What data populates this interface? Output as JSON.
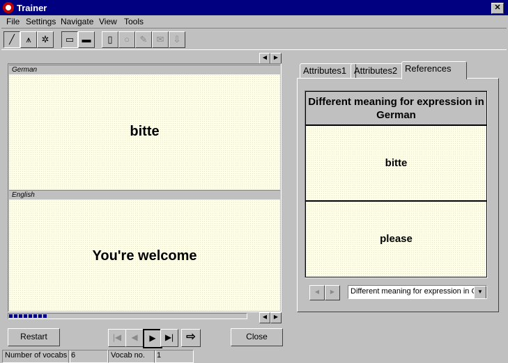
{
  "window": {
    "title": "Trainer",
    "close_glyph": "✕"
  },
  "menu": [
    "File",
    "Settings",
    "Navigate",
    "View",
    "Tools"
  ],
  "toolbar": [
    {
      "icon": "line-tool-icon",
      "glyph": "╱"
    },
    {
      "icon": "graph-icon",
      "glyph": "⩚"
    },
    {
      "icon": "bug-icon",
      "glyph": "✲"
    },
    {
      "icon": "monitor-icon",
      "glyph": "▭"
    },
    {
      "icon": "monitor-dark-icon",
      "glyph": "▬"
    },
    {
      "icon": "clipboard-icon",
      "glyph": "▯"
    },
    {
      "icon": "circle-icon",
      "glyph": "○"
    },
    {
      "icon": "pencil-icon",
      "glyph": "✎"
    },
    {
      "icon": "envelope-icon",
      "glyph": "✉"
    },
    {
      "icon": "download-icon",
      "glyph": "⇩"
    }
  ],
  "german": {
    "header": "German",
    "word": "bitte"
  },
  "english": {
    "header": "English",
    "word": "You're welcome"
  },
  "scroll": {
    "left": "◀",
    "right": "▶"
  },
  "progress": {
    "fraction": 0.16
  },
  "buttons": {
    "restart": "Restart",
    "close": "Close"
  },
  "nav": {
    "first": "|◀",
    "prev": "◀",
    "play": "▶",
    "last": "▶|",
    "goto": "⇨"
  },
  "tabs": [
    "Attributes1",
    "Attributes2",
    "References"
  ],
  "references": {
    "header": "Different meaning for expression in German",
    "rows": [
      "bitte",
      "please"
    ],
    "dropdown_value": "Different meaning for expression in Ge",
    "dropdown_arrow": "▼"
  },
  "statusbar": {
    "vocab_count_label": "Number of vocabs",
    "vocab_count": "6",
    "vocab_no_label": "Vocab no.",
    "vocab_no": "1"
  }
}
